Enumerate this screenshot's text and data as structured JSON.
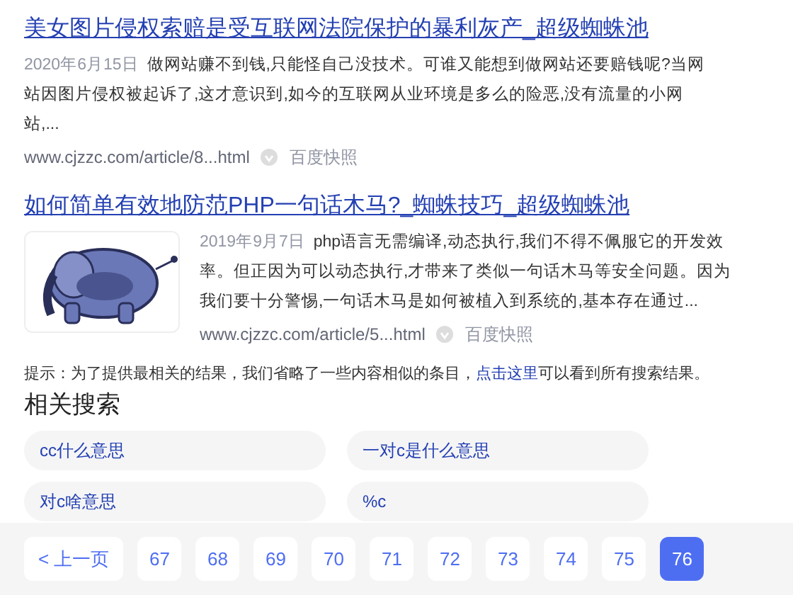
{
  "results": [
    {
      "title": "美女图片侵权索赔是受互联网法院保护的暴利灰产_超级蜘蛛池",
      "date": "2020年6月15日",
      "snippet": "做网站赚不到钱,只能怪自己没技术。可谁又能想到做网站还要赔钱呢?当网站因图片侵权被起诉了,这才意识到,如今的互联网从业环境是多么的险恶,没有流量的小网站,...",
      "url": "www.cjzzc.com/article/8...html",
      "cache": "百度快照"
    },
    {
      "title": "如何简单有效地防范PHP一句话木马?_蜘蛛技巧_超级蜘蛛池",
      "date": "2019年9月7日",
      "snippet": "php语言无需编译,动态执行,我们不得不佩服它的开发效率。但正因为可以动态执行,才带来了类似一句话木马等安全问题。因为我们要十分警惕,一句话木马是如何被植入到系统的,基本存在通过...",
      "url": "www.cjzzc.com/article/5...html",
      "cache": "百度快照"
    }
  ],
  "tip": {
    "before": "提示：为了提供最相关的结果，我们省略了一些内容相似的条目，",
    "link": "点击这里",
    "after": "可以看到所有搜索结果。"
  },
  "related": {
    "heading": "相关搜索",
    "items": [
      "cc什么意思",
      "一对c是什么意思",
      "对c啥意思",
      "%c"
    ]
  },
  "pagination": {
    "prev": "< 上一页",
    "pages": [
      {
        "label": "67",
        "selected": false
      },
      {
        "label": "68",
        "selected": false
      },
      {
        "label": "69",
        "selected": false
      },
      {
        "label": "70",
        "selected": false
      },
      {
        "label": "71",
        "selected": false
      },
      {
        "label": "72",
        "selected": false
      },
      {
        "label": "73",
        "selected": false
      },
      {
        "label": "74",
        "selected": false
      },
      {
        "label": "75",
        "selected": false
      },
      {
        "label": "76",
        "selected": true
      }
    ]
  }
}
